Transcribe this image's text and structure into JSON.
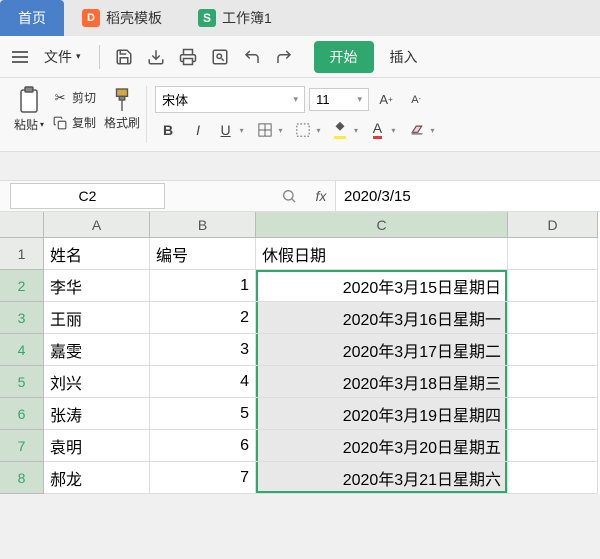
{
  "tabs": {
    "home": "首页",
    "docer": "稻壳模板",
    "workbook": "工作簿1"
  },
  "toolbar": {
    "file": "文件",
    "start": "开始",
    "insert": "插入"
  },
  "ribbon": {
    "paste": "粘贴",
    "cut": "剪切",
    "copy": "复制",
    "format_painter": "格式刷",
    "font_name": "宋体",
    "font_size": "11"
  },
  "formula": {
    "cell_ref": "C2",
    "value": "2020/3/15"
  },
  "columns": [
    "A",
    "B",
    "C",
    "D"
  ],
  "row_headers": [
    1,
    2,
    3,
    4,
    5,
    6,
    7,
    8
  ],
  "headers": {
    "name": "姓名",
    "id": "编号",
    "vacation_date": "休假日期"
  },
  "rows": [
    {
      "name": "李华",
      "id": 1,
      "date": "2020年3月15日星期日"
    },
    {
      "name": "王丽",
      "id": 2,
      "date": "2020年3月16日星期一"
    },
    {
      "name": "嘉雯",
      "id": 3,
      "date": "2020年3月17日星期二"
    },
    {
      "name": "刘兴",
      "id": 4,
      "date": "2020年3月18日星期三"
    },
    {
      "name": "张涛",
      "id": 5,
      "date": "2020年3月19日星期四"
    },
    {
      "name": "袁明",
      "id": 6,
      "date": "2020年3月20日星期五"
    },
    {
      "name": "郝龙",
      "id": 7,
      "date": "2020年3月21日星期六"
    }
  ]
}
